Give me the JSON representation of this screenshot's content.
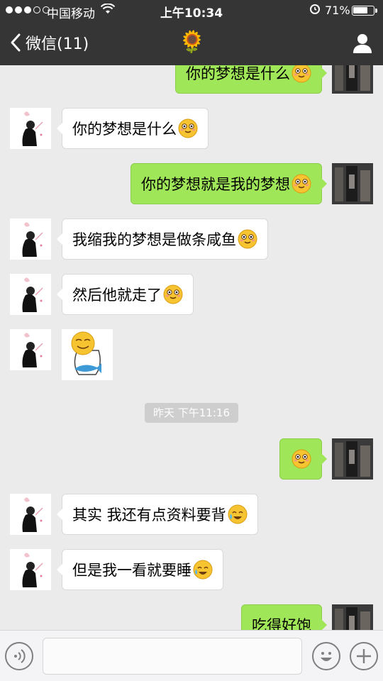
{
  "status_bar": {
    "carrier": "中国移动",
    "time": "上午10:34",
    "battery": "71%",
    "battery_level": 0.71
  },
  "nav": {
    "back_label": "微信(11)",
    "title_icon": "🌻"
  },
  "messages": [
    {
      "side": "right",
      "text": "你的梦想是什么",
      "emoji": "smile-emoji"
    },
    {
      "side": "left",
      "text": "你的梦想是什么",
      "emoji": "smile-emoji"
    },
    {
      "side": "right",
      "text": "你的梦想就是我的梦想",
      "emoji": "smile-emoji"
    },
    {
      "side": "left",
      "text": "我缩我的梦想是做条咸鱼",
      "emoji": "smile-emoji"
    },
    {
      "side": "left",
      "text": "然后他就走了",
      "emoji": "smile-emoji"
    },
    {
      "side": "left",
      "sticker": "emoji-fish-sticker"
    },
    {
      "timestamp": "昨天 下午11:16"
    },
    {
      "side": "right",
      "text": "",
      "emoji": "smile-emoji"
    },
    {
      "side": "left",
      "text": "其实 我还有点资料要背",
      "emoji": "crying-laughing-emoji"
    },
    {
      "side": "left",
      "text": "但是我一看就要睡",
      "emoji": "crying-laughing-emoji"
    },
    {
      "side": "right",
      "text": "吃得好饱"
    }
  ]
}
